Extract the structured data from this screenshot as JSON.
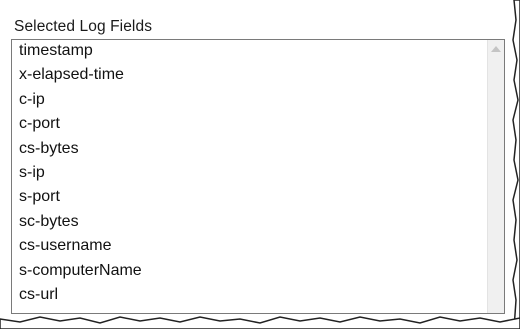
{
  "group": {
    "title": "Selected Log Fields"
  },
  "fields": [
    "timestamp",
    "x-elapsed-time",
    "c-ip",
    "c-port",
    "cs-bytes",
    "s-ip",
    "s-port",
    "sc-bytes",
    "cs-username",
    "s-computerName",
    "cs-url"
  ],
  "icons": {
    "scroll_up": "scroll-up-arrow-icon"
  },
  "colors": {
    "border": "#7a7a7a",
    "scrollbar": "#f0f0f0",
    "text": "#111111"
  }
}
